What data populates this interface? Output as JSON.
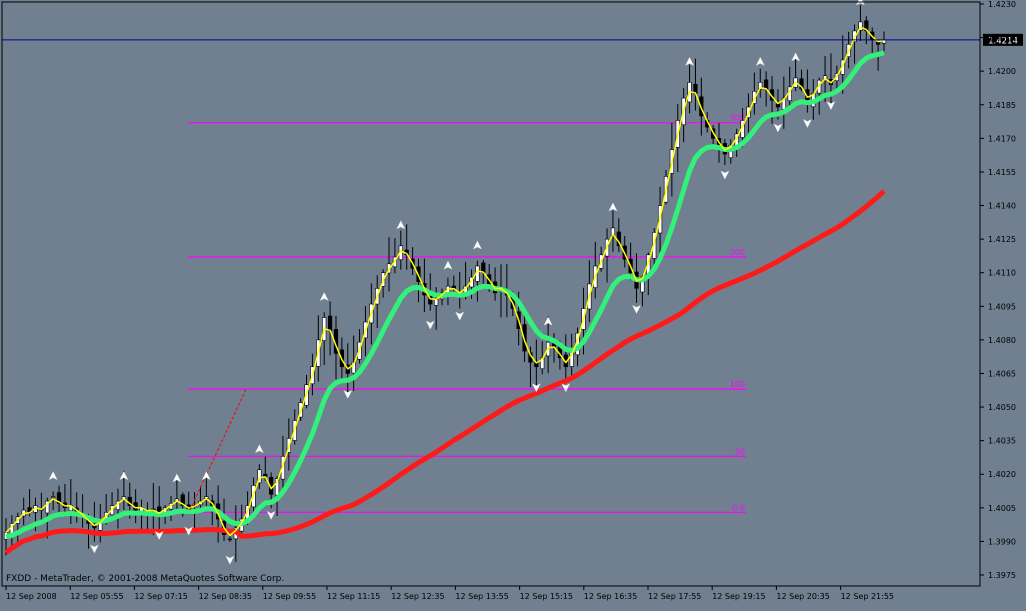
{
  "chart_data": {
    "type": "candlestick",
    "symbol": "FXDD - MetaTrader, © 2001-2008 MetaQuotes Software Corp.",
    "current_price_label": "1.4214",
    "current_price": 1.4214,
    "ylim": [
      1.3968,
      1.4232
    ],
    "y_ticks": [
      1.423,
      1.4215,
      1.42,
      1.4185,
      1.417,
      1.4155,
      1.414,
      1.4125,
      1.411,
      1.4095,
      1.408,
      1.4065,
      1.405,
      1.4035,
      1.402,
      1.4005,
      1.399,
      1.3975
    ],
    "y_tick_labels": [
      "1.4230",
      "1.4215",
      "1.4200",
      "1.4185",
      "1.4170",
      "1.4155",
      "1.4140",
      "1.4125",
      "1.4110",
      "1.4095",
      "1.4080",
      "1.4065",
      "1.4050",
      "1.4035",
      "1.4020",
      "1.4005",
      "1.3990",
      "1.3975"
    ],
    "x_tick_labels": [
      "12 Sep 2008",
      "12 Sep 05:55",
      "12 Sep 07:15",
      "12 Sep 08:35",
      "12 Sep 09:55",
      "12 Sep 11:15",
      "12 Sep 12:35",
      "12 Sep 13:55",
      "12 Sep 15:15",
      "12 Sep 16:35",
      "12 Sep 17:55",
      "12 Sep 19:15",
      "12 Sep 20:35",
      "12 Sep 21:55"
    ],
    "close_series": [
      1.3994,
      1.3998,
      1.4001,
      1.4004,
      1.4003,
      1.4006,
      1.4004,
      1.4008,
      1.401,
      1.4007,
      1.4005,
      1.4006,
      1.4003,
      1.4001,
      1.3998,
      1.3996,
      1.3999,
      1.4003,
      1.4006,
      1.4008,
      1.401,
      1.4006,
      1.4004,
      1.4005,
      1.4003,
      1.4004,
      1.4002,
      1.4005,
      1.4007,
      1.4009,
      1.4006,
      1.4004,
      1.4006,
      1.4008,
      1.401,
      1.4006,
      1.4,
      1.3993,
      1.3991,
      1.3996,
      1.4,
      1.4006,
      1.4015,
      1.4022,
      1.4019,
      1.4011,
      1.4018,
      1.4028,
      1.4036,
      1.4044,
      1.4052,
      1.406,
      1.4068,
      1.408,
      1.409,
      1.4084,
      1.4074,
      1.4068,
      1.4065,
      1.407,
      1.4079,
      1.4088,
      1.4096,
      1.4103,
      1.411,
      1.4114,
      1.4117,
      1.4122,
      1.4118,
      1.4112,
      1.4106,
      1.41,
      1.4096,
      1.4098,
      1.4101,
      1.4104,
      1.4103,
      1.41,
      1.4104,
      1.4108,
      1.4113,
      1.411,
      1.4105,
      1.4101,
      1.4103,
      1.41,
      1.4094,
      1.4085,
      1.4075,
      1.407,
      1.4068,
      1.4072,
      1.4079,
      1.4077,
      1.4072,
      1.4068,
      1.4075,
      1.4083,
      1.4094,
      1.4105,
      1.4113,
      1.4118,
      1.4125,
      1.413,
      1.4122,
      1.4116,
      1.411,
      1.4103,
      1.4108,
      1.4118,
      1.4128,
      1.414,
      1.4153,
      1.4165,
      1.4178,
      1.4188,
      1.4195,
      1.419,
      1.418,
      1.4175,
      1.417,
      1.4166,
      1.4163,
      1.4167,
      1.4172,
      1.4178,
      1.4184,
      1.4191,
      1.4195,
      1.4192,
      1.4187,
      1.4184,
      1.4188,
      1.4193,
      1.4197,
      1.4192,
      1.4186,
      1.419,
      1.4196,
      1.4198,
      1.4194,
      1.4199,
      1.4205,
      1.4212,
      1.4218,
      1.4222,
      1.4218,
      1.4214,
      1.4212,
      1.4214
    ],
    "series": [
      {
        "name": "",
        "color": "#ffff00",
        "role": "fast-ma"
      },
      {
        "name": "",
        "color": "#32f07a",
        "role": "medium-ma"
      },
      {
        "name": "",
        "color": "#ff1a1a",
        "role": "slow-ma"
      }
    ],
    "fibonacci_levels": [
      {
        "label": "0.0",
        "price": 1.4003
      },
      {
        "label": "50",
        "price": 1.4028
      },
      {
        "label": "100",
        "price": 1.4058
      },
      {
        "label": "200",
        "price": 1.4117
      },
      {
        "label": "300",
        "price": 1.4177
      }
    ],
    "fibonacci_color": "#ff00ff",
    "colors": {
      "background": "#708090",
      "candle_up": "#ffffff",
      "candle_down": "#000000",
      "current_price_line": "#00008b",
      "axis": "#000000",
      "trendline": "#ff0000"
    }
  }
}
